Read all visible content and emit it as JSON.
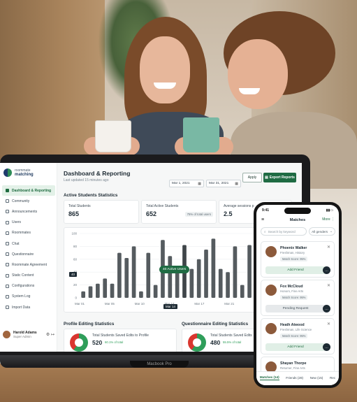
{
  "sidebar": {
    "brand": {
      "top": "roommate",
      "bottom": "matching"
    },
    "items": [
      {
        "label": "Dashboard & Reporting",
        "active": true
      },
      {
        "label": "Community"
      },
      {
        "label": "Announcements"
      },
      {
        "label": "Users"
      },
      {
        "label": "Roommates"
      },
      {
        "label": "Chat"
      },
      {
        "label": "Questionnaire"
      },
      {
        "label": "Roommate Agreement"
      },
      {
        "label": "Static Content"
      },
      {
        "label": "Configurations"
      },
      {
        "label": "System Log"
      },
      {
        "label": "Import Data"
      }
    ],
    "user": {
      "name": "Harold Adams",
      "role": "Super Admin"
    }
  },
  "header": {
    "title": "Dashboard & Reporting",
    "subtitle": "Last updated 15 minutes ago",
    "date_from": "Mar 1, 2021",
    "date_to": "Mar 31, 2021",
    "apply_label": "Apply",
    "export_label": "Export Reports"
  },
  "active_section": {
    "title": "Active Students Statistics",
    "stats": [
      {
        "label": "Total Students",
        "value": "865"
      },
      {
        "label": "Total Active Students",
        "value": "652",
        "badge": "75% of total users"
      },
      {
        "label": "Average sessions p",
        "value": "2.5"
      }
    ]
  },
  "chart_data": {
    "type": "bar",
    "yticks": [
      "100",
      "80",
      "60",
      "40",
      "20",
      "0"
    ],
    "ylim": [
      0,
      100
    ],
    "x_tick_labels": [
      "Mar 01",
      "Mar 05",
      "Mar 10",
      "Mar 14",
      "Mar 17",
      "Mar 21",
      "Mar 25",
      "Mar 31"
    ],
    "values": [
      10,
      18,
      22,
      30,
      22,
      70,
      62,
      80,
      10,
      70,
      20,
      90,
      65,
      40,
      82,
      45,
      60,
      75,
      92,
      45,
      40,
      80,
      20,
      82,
      92,
      85,
      70,
      55,
      35
    ],
    "highlight_label": "40 Active Users",
    "highlight_index": 14,
    "color": "#555b5f",
    "y_marker": "40",
    "selected_date": "Mar 14"
  },
  "bottom": {
    "left_title": "Profile Editing Statistics",
    "left_card_label": "Total Students Saved Edits to Profile",
    "left_value": "520",
    "left_pct": "60.1% of total",
    "right_title": "Questionnaire Editing Statistics",
    "right_card_label": "Total Students Saved Edits",
    "right_value": "480",
    "right_pct": "55.5% of total"
  },
  "laptop_label": "Macbook Pro",
  "phone": {
    "time": "9:41",
    "title": "Matches",
    "more": "More",
    "search_placeholder": "Search by keyword",
    "filter": "All genders",
    "cards": [
      {
        "name": "Phoenix Walker",
        "meta": "Freshman, History",
        "score": "Match Score: 95%",
        "action": "Add Friend",
        "state": "add"
      },
      {
        "name": "Fox McCloud",
        "meta": "Honors, Fine Arts",
        "score": "Match Score: 95%",
        "action": "Pending Request",
        "state": "pending"
      },
      {
        "name": "Heath Atwood",
        "meta": "Freshman, Life Science",
        "score": "Match Score: 95%",
        "action": "Add Friend",
        "state": "add"
      },
      {
        "name": "Shayan Thorpe",
        "meta": "Returner, Fine Arts",
        "score": "",
        "action": "",
        "state": "partial"
      }
    ],
    "tabs": [
      "Matches (14)",
      "Friends (28)",
      "New (15)",
      "Rec"
    ]
  },
  "colors": {
    "accent": "#1f6b43",
    "bar": "#555b5f",
    "pie_green": "#2f9e5a",
    "pie_red": "#d9362f"
  }
}
